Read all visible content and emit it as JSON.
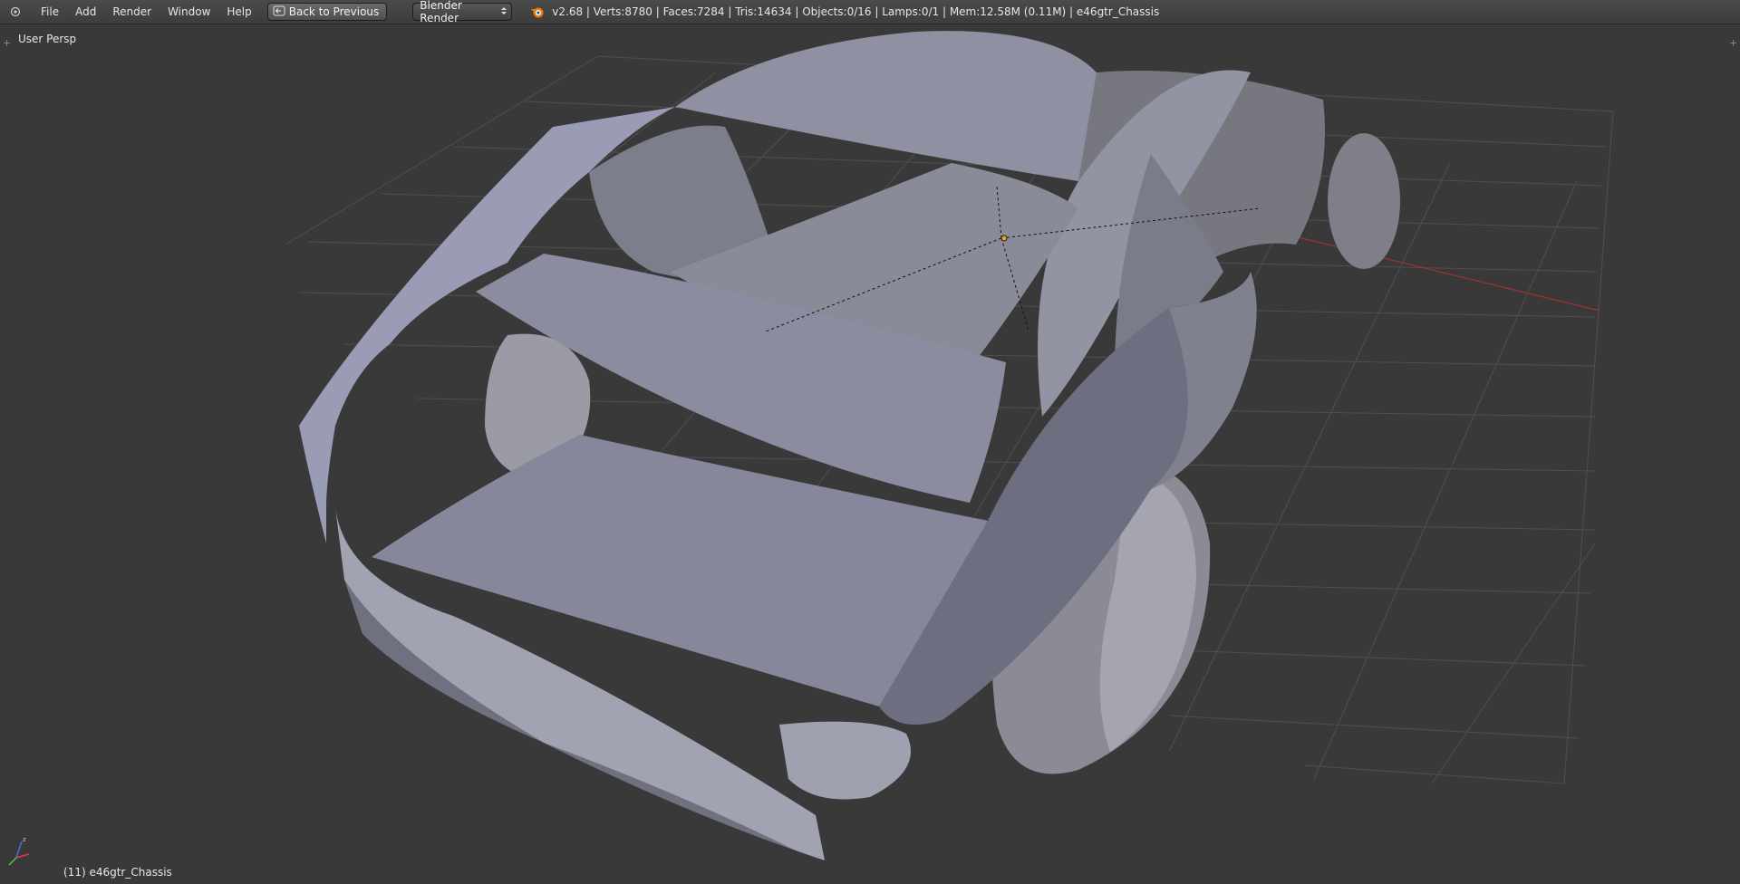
{
  "header": {
    "menu": [
      "File",
      "Add",
      "Render",
      "Window",
      "Help"
    ],
    "back_button": "Back to Previous",
    "render_engine": "Blender Render",
    "stats": "v2.68 | Verts:8780 | Faces:7284 | Tris:14634 | Objects:0/16 | Lamps:0/1 | Mem:12.58M (0.11M) | e46gtr_Chassis"
  },
  "viewport": {
    "view_name": "User Persp",
    "active_object": "(11) e46gtr_Chassis",
    "axes": {
      "x_color": "#e23b3b",
      "y_color": "#52c152",
      "z_color": "#4f6fe2"
    }
  },
  "colors": {
    "background": "#393939",
    "header": "#454545",
    "grid": "#4e4e4e",
    "model": "#8e90a6"
  },
  "icons": [
    "editor-type-icon",
    "back-arrow-icon",
    "select-arrows-icon",
    "blender-logo-icon"
  ]
}
